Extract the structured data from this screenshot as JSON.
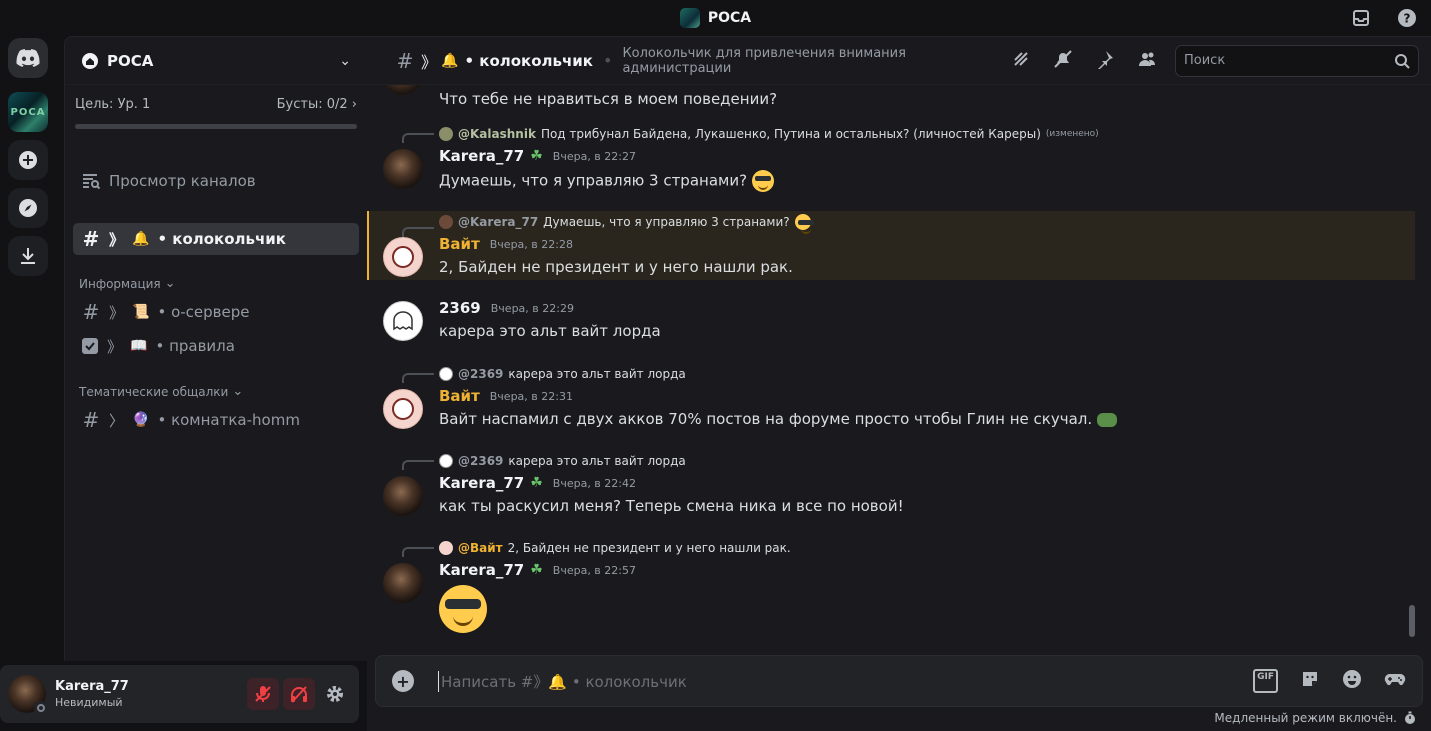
{
  "window": {
    "title": "POCA"
  },
  "rail": {
    "server_label": "POCA"
  },
  "server": {
    "name": "POCA",
    "boost": {
      "goal": "Цель: Ур. 1",
      "boosts": "Бусты: 0/2"
    },
    "browse_channels": "Просмотр каналов",
    "active_channel": "# 》🔔 • колокольчик",
    "active_channel_name": "• колокольчик",
    "categories": [
      {
        "name": "Информация",
        "channels": [
          {
            "name": "• о-сервере",
            "emoji": "📜"
          },
          {
            "name": "• правила",
            "emoji": "📖"
          }
        ]
      },
      {
        "name": "Тематические общалки",
        "channels": [
          {
            "name": "• комнатка-homm",
            "emoji": "🔮"
          }
        ]
      }
    ]
  },
  "user": {
    "name": "Karera_77",
    "status": "Невидимый"
  },
  "header": {
    "channel": "• колокольчик",
    "topic": "Колокольчик для привлечения внимания администрации",
    "search_placeholder": "Поиск"
  },
  "messages": [
    {
      "text": "Что тебе не нравиться в моем поведении?"
    },
    {
      "reply_to": "@Kalashnik",
      "reply_text": "Под трибунал Байдена, Лукашенко, Путина и остальных? (личностей Кареры)",
      "reply_edited": "(изменено)",
      "author": "Karera_77",
      "time": "Вчера, в 22:27",
      "text": "Думаешь, что я управляю 3 странами?"
    },
    {
      "reply_to": "@Karera_77",
      "reply_text": "Думаешь, что я управляю 3 странами?",
      "author": "Вайт",
      "time": "Вчера, в 22:28",
      "text": "2, Байден не президент  и у  него нашли рак."
    },
    {
      "author": "2369",
      "time": "Вчера, в 22:29",
      "text": "карера это альт вайт лорда"
    },
    {
      "reply_to": "@2369",
      "reply_text": "карера это альт вайт лорда",
      "author": "Вайт",
      "time": "Вчера, в 22:31",
      "text": "Вайт наспамил с двух акков 70% постов на форуме просто чтобы Глин не скучал."
    },
    {
      "reply_to": "@2369",
      "reply_text": "карера это альт вайт лорда",
      "author": "Karera_77",
      "time": "Вчера, в 22:42",
      "text": "как ты раскусил меня? Теперь смена ника и все по новой!"
    },
    {
      "reply_to": "@Вайт",
      "reply_text": "2, Байден не президент  и у  него нашли рак.",
      "author": "Karera_77",
      "time": "Вчера, в 22:57",
      "text": ""
    }
  ],
  "composer": {
    "placeholder": "Написать #》🔔 • колокольчик",
    "gif_label": "GIF"
  },
  "slowmode": "Медленный режим включён."
}
